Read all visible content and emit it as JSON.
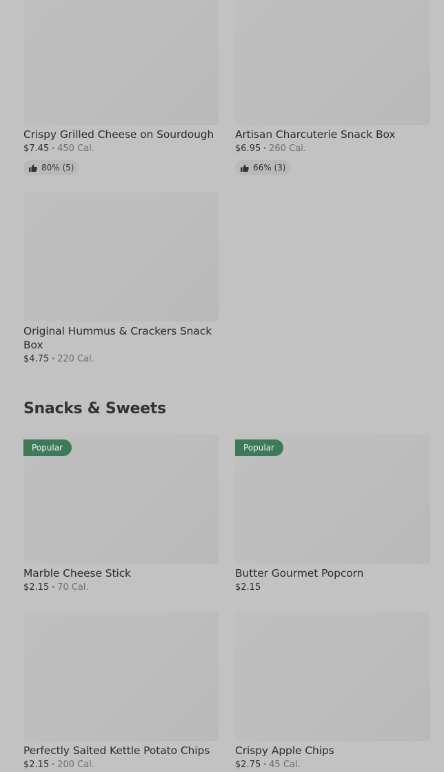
{
  "items_top": [
    {
      "name": "Crispy Grilled Cheese on Sourdough",
      "price": "$7.45",
      "calories": "450 Cal.",
      "rating": "80% (5)"
    },
    {
      "name": "Artisan Charcuterie Snack Box",
      "price": "$6.95",
      "calories": "260 Cal.",
      "rating": "66% (3)"
    },
    {
      "name": "Original Hummus & Crackers Snack Box",
      "price": "$4.75",
      "calories": "220 Cal."
    }
  ],
  "section": {
    "title": "Snacks & Sweets"
  },
  "items_snacks": [
    {
      "name": "Marble Cheese Stick",
      "price": "$2.15",
      "calories": "70 Cal.",
      "badge": "Popular"
    },
    {
      "name": "Butter Gourmet Popcorn",
      "price": "$2.15",
      "badge": "Popular"
    },
    {
      "name": "Perfectly Salted Kettle Potato Chips",
      "price": "$2.15",
      "calories": "200 Cal."
    },
    {
      "name": "Crispy Apple Chips",
      "price": "$2.75",
      "calories": "45 Cal."
    }
  ],
  "icons": {
    "rating": "thumbs-up-icon"
  },
  "colors": {
    "badge": "#3e7a5a",
    "background": "#c2c2c2"
  }
}
